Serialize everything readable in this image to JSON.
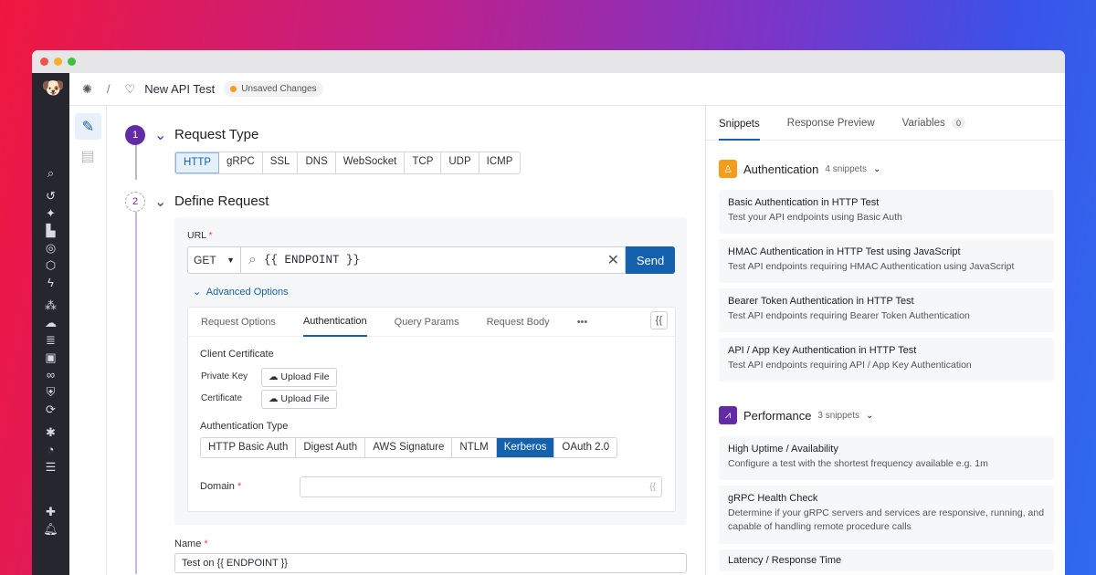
{
  "header": {
    "title": "New API Test",
    "separator": "/",
    "status": "Unsaved Changes"
  },
  "steps": [
    {
      "number": "1",
      "title": "Request Type"
    },
    {
      "number": "2",
      "title": "Define Request"
    }
  ],
  "request_types": [
    "HTTP",
    "gRPC",
    "SSL",
    "DNS",
    "WebSocket",
    "TCP",
    "UDP",
    "ICMP"
  ],
  "url": {
    "label": "URL",
    "required": "*",
    "method": "GET",
    "value": "{{ ENDPOINT }}",
    "send": "Send"
  },
  "advanced": "Advanced Options",
  "option_tabs": [
    "Request Options",
    "Authentication",
    "Query Params",
    "Request Body",
    "•••"
  ],
  "variable_button": "{{",
  "client_cert": {
    "title": "Client Certificate",
    "private_key": "Private Key",
    "certificate": "Certificate",
    "upload": "Upload File"
  },
  "auth_type": {
    "title": "Authentication Type",
    "options": [
      "HTTP Basic Auth",
      "Digest Auth",
      "AWS Signature",
      "NTLM",
      "Kerberos",
      "OAuth 2.0"
    ],
    "selected": "Kerberos"
  },
  "domain": {
    "label": "Domain",
    "required": "*",
    "value": ""
  },
  "name": {
    "label": "Name",
    "required": "*",
    "value": "Test on {{ ENDPOINT }}"
  },
  "right_tabs": {
    "snippets": "Snippets",
    "preview": "Response Preview",
    "variables": "Variables",
    "variables_count": "0"
  },
  "sections": [
    {
      "title": "Authentication",
      "count": "4 snippets",
      "color": "#f59c1a",
      "items": [
        {
          "title": "Basic Authentication in HTTP Test",
          "desc": "Test your API endpoints using Basic Auth"
        },
        {
          "title": "HMAC Authentication in HTTP Test using JavaScript",
          "desc": "Test API endpoints requiring HMAC Authentication using JavaScript"
        },
        {
          "title": "Bearer Token Authentication in HTTP Test",
          "desc": "Test API endpoints requiring Bearer Token Authentication"
        },
        {
          "title": "API / App Key Authentication in HTTP Test",
          "desc": "Test API endpoints requiring API / App Key Authentication"
        }
      ]
    },
    {
      "title": "Performance",
      "count": "3 snippets",
      "color": "#632ca6",
      "items": [
        {
          "title": "High Uptime / Availability",
          "desc": "Configure a test with the shortest frequency available e.g. 1m"
        },
        {
          "title": "gRPC Health Check",
          "desc": "Determine if your gRPC servers and services are responsive, running, and capable of handling remote procedure calls"
        },
        {
          "title": "Latency / Response Time",
          "desc": ""
        }
      ]
    }
  ],
  "colors": {
    "accent": "#1461ad",
    "step": "#632ca6"
  }
}
